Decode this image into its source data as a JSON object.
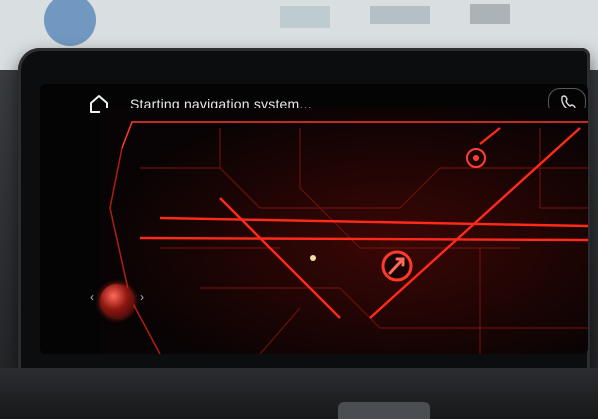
{
  "status_bar": {
    "home_icon": "home-icon",
    "title": "Starting navigation system...",
    "phone_icon": "phone-icon"
  },
  "map": {
    "style": "red-circuit-network",
    "accent": "#ff2a1a",
    "dim": "#5a0c08"
  },
  "controller": {
    "left_chevron": "‹",
    "right_chevron": "›"
  }
}
